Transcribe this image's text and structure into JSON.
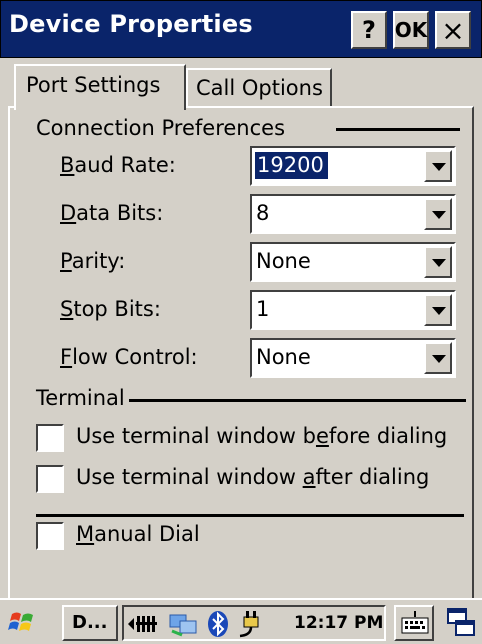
{
  "window": {
    "title": "Device Properties",
    "help_label": "?",
    "ok_label": "OK",
    "close_label": "×"
  },
  "tabs": [
    {
      "label": "Port Settings",
      "active": true
    },
    {
      "label": "Call Options",
      "active": false
    }
  ],
  "connection": {
    "group_label": "Connection Preferences",
    "fields": [
      {
        "label_prefix": "",
        "mnemonic": "B",
        "label_rest": "aud Rate:",
        "value": "19200",
        "selected": true
      },
      {
        "label_prefix": "",
        "mnemonic": "D",
        "label_rest": "ata Bits:",
        "value": "8"
      },
      {
        "label_prefix": "",
        "mnemonic": "P",
        "label_rest": "arity:",
        "value": "None"
      },
      {
        "label_prefix": "",
        "mnemonic": "S",
        "label_rest": "top Bits:",
        "value": "1"
      },
      {
        "label_prefix": "",
        "mnemonic": "F",
        "label_rest": "low Control:",
        "value": "None"
      }
    ]
  },
  "terminal": {
    "group_label": "Terminal",
    "options": [
      {
        "prefix": "Use terminal window b",
        "mnemonic": "e",
        "suffix": "fore dialing",
        "checked": false
      },
      {
        "prefix": "Use terminal window ",
        "mnemonic": "a",
        "suffix": "fter dialing",
        "checked": false
      }
    ]
  },
  "manual_dial": {
    "prefix": "",
    "mnemonic": "M",
    "suffix": "anual Dial",
    "checked": false
  },
  "taskbar": {
    "task_label": "D...",
    "clock": "12:17 PM",
    "icons": [
      "start-icon",
      "signal-icon",
      "network-icon",
      "bluetooth-icon",
      "power-plug-icon",
      "keyboard-icon",
      "window-switch-icon"
    ]
  },
  "colors": {
    "titlebar": "#0a246a",
    "selection": "#0a246a",
    "face": "#d4d0c8"
  }
}
